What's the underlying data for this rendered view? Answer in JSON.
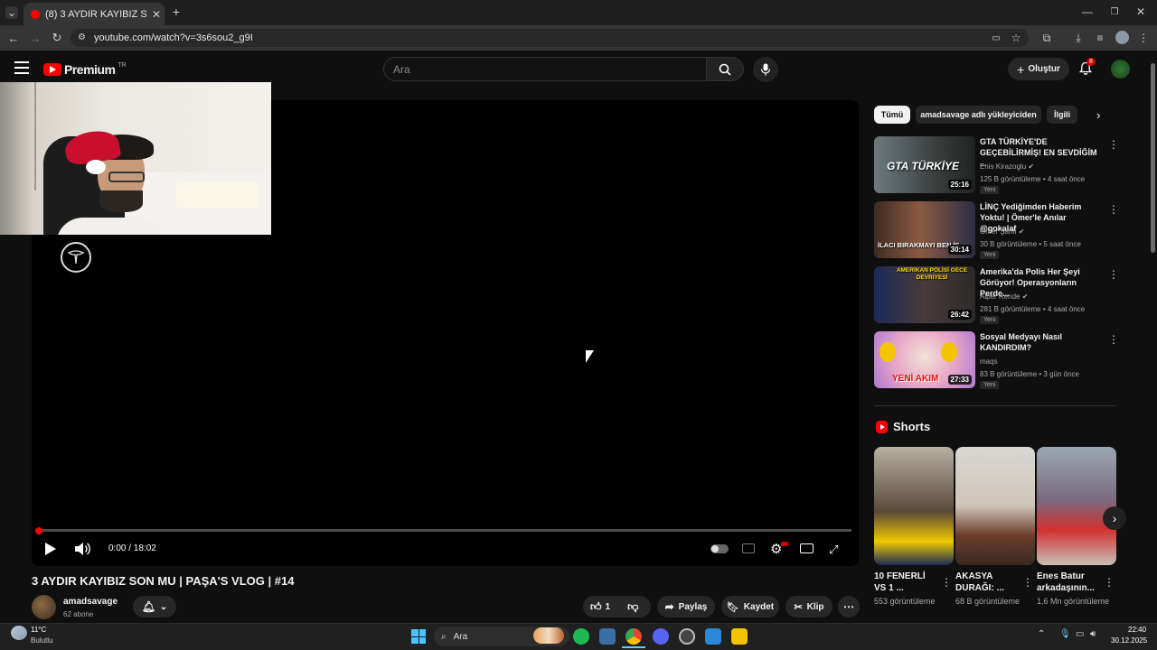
{
  "browser": {
    "tab_title": "(8) 3 AYDIR KAYIBIZ SON MU | P",
    "url": "youtube.com/watch?v=3s6sou2_g9I"
  },
  "header": {
    "logo_text": "Premium",
    "region": "TR",
    "search_placeholder": "Ara",
    "create_label": "Oluştur",
    "notification_count": "8"
  },
  "player": {
    "time": "0:00 / 18:02",
    "progress": 0.0
  },
  "video": {
    "title": "3 AYDIR KAYIBIZ SON MU | PAŞA'S VLOG | #14",
    "channel": "amadsavage",
    "subscribers": "62 abone",
    "likes": "1",
    "share_label": "Paylaş",
    "save_label": "Kaydet",
    "clip_label": "Klip"
  },
  "filters": [
    "Tümü",
    "amadsavage adlı yükleyiciden",
    "İlgili"
  ],
  "recommendations": [
    {
      "title": "GTA TÜRKİYE'DE GEÇEBİLİRMİŞ! EN SEVDİĞİM ...",
      "channel": "Enis Kirazoglu",
      "views": "125 B görüntüleme • 4 saat önce",
      "badge": "Yeni",
      "duration": "25:16",
      "thumb_text": "GTA TÜRKİYE"
    },
    {
      "title": "LİNÇ Yediğimden Haberim Yoktu! | Ömer'le Anılar @gokalaf",
      "channel": "Ömer Şanlı",
      "views": "30 B görüntüleme • 5 saat önce",
      "badge": "Yeni",
      "duration": "30:14",
      "thumb_text": "İLACI BIRAKMAYI BEN İS"
    },
    {
      "title": "Amerika'da Polis Her Şeyi Görüyor! Operasyonların Perde...",
      "channel": "Alper Rende",
      "views": "281 B görüntüleme • 4 saat önce",
      "badge": "Yeni",
      "duration": "26:42",
      "thumb_text": "AMERİKAN POLİSİ GECE DEVRİYESİ"
    },
    {
      "title": "Sosyal Medyayı Nasıl KANDIRDIM?",
      "channel": "maqs",
      "views": "83 B görüntüleme • 3 gün önce",
      "badge": "Yeni",
      "duration": "27:33",
      "thumb_text": "YENİ AKIM"
    }
  ],
  "shorts": {
    "heading": "Shorts",
    "items": [
      {
        "title": "10 FENERLİ VS 1 ...",
        "views": "553 görüntüleme"
      },
      {
        "title": "AKASYA DURAĞI: ...",
        "views": "68 B görüntüleme"
      },
      {
        "title": "Enes Batur arkadaşının...",
        "views": "1,6 Mn görüntüleme"
      }
    ]
  },
  "taskbar": {
    "weather_temp": "11°C",
    "weather_desc": "Bulutlu",
    "search_label": "Ara",
    "time": "22:40",
    "date": "30.12.2025"
  },
  "colors": {
    "accent": "#ff0000",
    "background": "#0f0f0f"
  }
}
